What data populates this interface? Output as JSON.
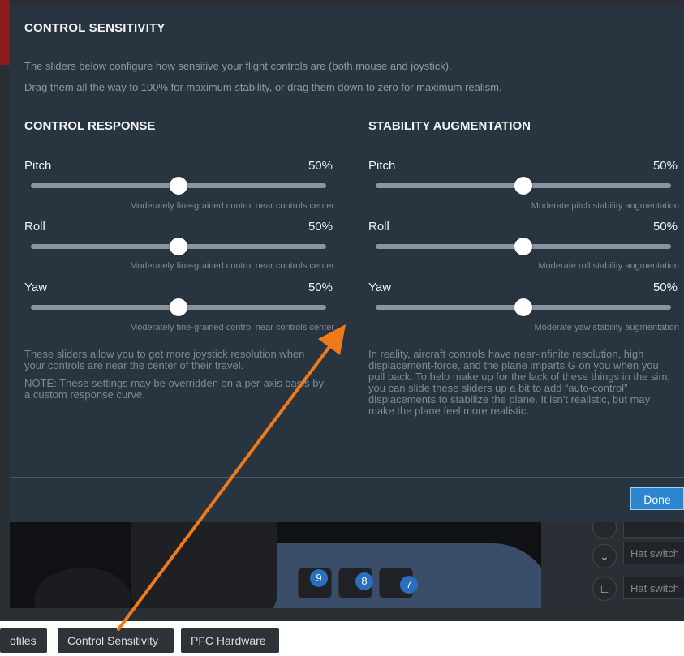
{
  "modal": {
    "title": "CONTROL SENSITIVITY",
    "description_line1": "The sliders below configure how sensitive your flight controls are (both mouse and joystick).",
    "description_line2": "Drag them all the way to 100% for maximum stability, or drag them down to zero for maximum realism.",
    "done_label": "Done"
  },
  "control_response": {
    "title": "CONTROL RESPONSE",
    "sliders": [
      {
        "label": "Pitch",
        "value_text": "50%",
        "value": 0.5,
        "hint": "Moderately fine-grained control near controls center"
      },
      {
        "label": "Roll",
        "value_text": "50%",
        "value": 0.5,
        "hint": "Moderately fine-grained control near controls center"
      },
      {
        "label": "Yaw",
        "value_text": "50%",
        "value": 0.5,
        "hint": "Moderately fine-grained control near controls center"
      }
    ],
    "paragraph1": "These sliders allow you to get more joystick resolution when your controls are near the center of their travel.",
    "paragraph2": "NOTE: These settings may be overridden on a per-axis basis by a custom response curve."
  },
  "stability_augmentation": {
    "title": "STABILITY AUGMENTATION",
    "sliders": [
      {
        "label": "Pitch",
        "value_text": "50%",
        "value": 0.5,
        "hint": "Moderate pitch stability augmentation"
      },
      {
        "label": "Roll",
        "value_text": "50%",
        "value": 0.5,
        "hint": "Moderate roll stability augmentation"
      },
      {
        "label": "Yaw",
        "value_text": "50%",
        "value": 0.5,
        "hint": "Moderate yaw stability augmentation"
      }
    ],
    "paragraph": "In reality, aircraft controls have near-infinite resolution, high displacement-force, and the plane imparts G on you when you pull back. To help make up for the lack of these things in the sim, you can slide these sliders up a bit to add “auto-control” displacements to stabilize the plane. It isn't realistic, but may make the plane feel more realistic."
  },
  "background": {
    "joystick_buttons": [
      "9",
      "8",
      "7"
    ],
    "hat_switch_label": "Hat switch",
    "tabs": [
      "ofiles",
      "Control Sensitivity",
      "PFC Hardware"
    ]
  },
  "colors": {
    "modal_bg": "#283540",
    "accent": "#2d85cf",
    "arrow": "#f07a1a"
  }
}
